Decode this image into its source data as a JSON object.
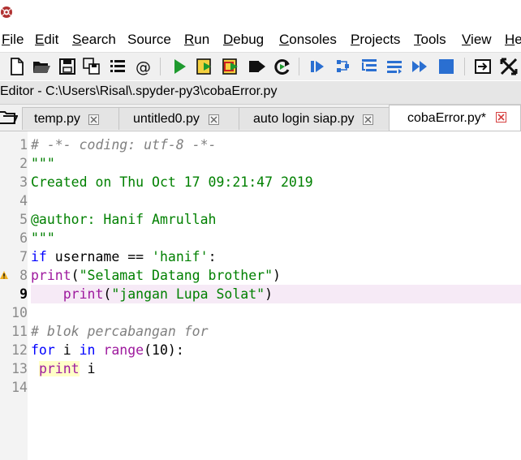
{
  "menu": {
    "items": [
      {
        "label": "File",
        "u": "F",
        "rest": "ile"
      },
      {
        "label": "Edit",
        "u": "E",
        "rest": "dit"
      },
      {
        "label": "Search",
        "u": "S",
        "rest": "earch"
      },
      {
        "label": "Source",
        "u": "",
        "rest": "Source"
      },
      {
        "label": "Run",
        "u": "R",
        "rest": "un"
      },
      {
        "label": "Debug",
        "u": "D",
        "rest": "ebug"
      },
      {
        "label": "Consoles",
        "u": "C",
        "rest": "onsoles"
      },
      {
        "label": "Projects",
        "u": "P",
        "rest": "rojects"
      },
      {
        "label": "Tools",
        "u": "T",
        "rest": "ools"
      },
      {
        "label": "View",
        "u": "V",
        "rest": "iew"
      },
      {
        "label": "He",
        "u": "H",
        "rest": "e"
      }
    ]
  },
  "toolbar": {
    "icons": [
      "new-file-icon",
      "open-folder-icon",
      "save-icon",
      "save-all-icon",
      "list-icon",
      "at-icon",
      "run-icon",
      "run-cell-icon",
      "run-cell-advance-icon",
      "run-selection-icon",
      "rerun-icon",
      "debug-icon",
      "step-icon",
      "step-into-icon",
      "step-return-icon",
      "continue-icon",
      "stop-icon",
      "maximize-pane-icon",
      "fullscreen-icon"
    ]
  },
  "editor_path": "Editor - C:\\Users\\Risal\\.spyder-py3\\cobaError.py",
  "tabs": [
    {
      "label": "temp.py",
      "active": false
    },
    {
      "label": "untitled0.py",
      "active": false
    },
    {
      "label": "auto login siap.py",
      "active": false
    },
    {
      "label": "cobaError.py*",
      "active": true
    }
  ],
  "code": {
    "line_numbers": [
      "1",
      "2",
      "3",
      "4",
      "5",
      "6",
      "7",
      "8",
      "9",
      "10",
      "11",
      "12",
      "13",
      "14"
    ],
    "current_line": "9",
    "warning_line": "8",
    "lines": {
      "l1": "# -*- coding: utf-8 -*-",
      "l2": "\"\"\"",
      "l3": "Created on Thu Oct 17 09:21:47 2019",
      "l5": "@author: Hanif Amrullah",
      "l6": "\"\"\"",
      "l7_kw": "if",
      "l7_rest": " username == ",
      "l7_str": "'hanif'",
      "l7_end": ":",
      "l8_fn": "print",
      "l8_open": "(",
      "l8_str": "\"Selamat Datang brother\"",
      "l8_close": ")",
      "l9_indent": "    ",
      "l9_fn": "print",
      "l9_open": "(",
      "l9_str": "\"jangan Lupa Solat\"",
      "l9_close": ")",
      "l11": "# blok percabangan for",
      "l12_kw1": "for",
      "l12_a": " i ",
      "l12_kw2": "in",
      "l12_sp": " ",
      "l12_fn": "range",
      "l12_b": "(",
      "l12_num": "10",
      "l12_c": "):",
      "l13_indent": " ",
      "l13_fn": "print",
      "l13_rest": " i"
    }
  },
  "colors": {
    "keyword": "#0000ff",
    "builtin": "#9e1a9e",
    "string": "#008000",
    "comment": "#808080",
    "current_line_bg": "#f6eaf6"
  }
}
